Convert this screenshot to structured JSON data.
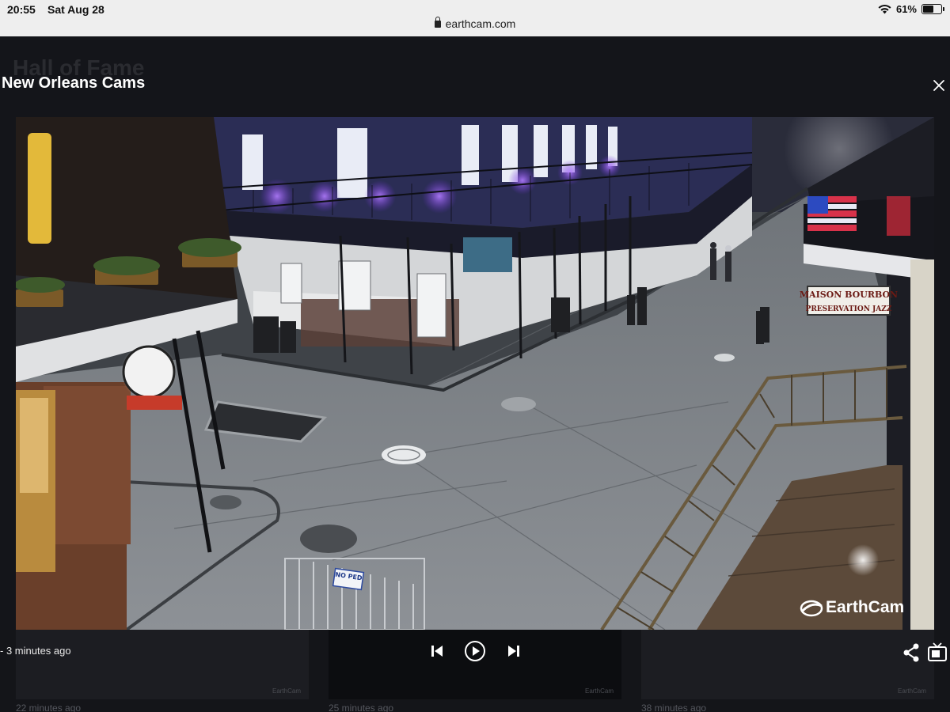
{
  "status_bar": {
    "time": "20:55",
    "date": "Sat Aug 28",
    "battery_text": "61%",
    "battery_level": 0.61
  },
  "browser": {
    "url": "earthcam.com"
  },
  "page": {
    "background_title": "Hall of Fame"
  },
  "modal": {
    "title": "New Orleans Cams",
    "close_icon": "close-icon"
  },
  "video": {
    "watermark": "EarthCam",
    "signs": {
      "bar_sign_line1": "MAISON BOURBON",
      "bar_sign_line2": "PRESERVATION JAZZ",
      "barricade_sign": "NO PED"
    }
  },
  "player": {
    "time_ago": "- 3 minutes ago",
    "controls": {
      "previous_icon": "skip-previous-icon",
      "play_icon": "play-icon",
      "next_icon": "skip-next-icon",
      "share_icon": "share-icon",
      "tv_icon": "tv-icon"
    }
  },
  "thumbnails": [
    {
      "label": "22 minutes ago",
      "logo": "EarthCam"
    },
    {
      "label": "25 minutes ago",
      "logo": "EarthCam"
    },
    {
      "label": "38 minutes ago",
      "logo": "EarthCam"
    }
  ],
  "colors": {
    "accent_white": "#ffffff",
    "overlay_bg": "#14151a",
    "statusbar_bg": "#eeeeee"
  }
}
